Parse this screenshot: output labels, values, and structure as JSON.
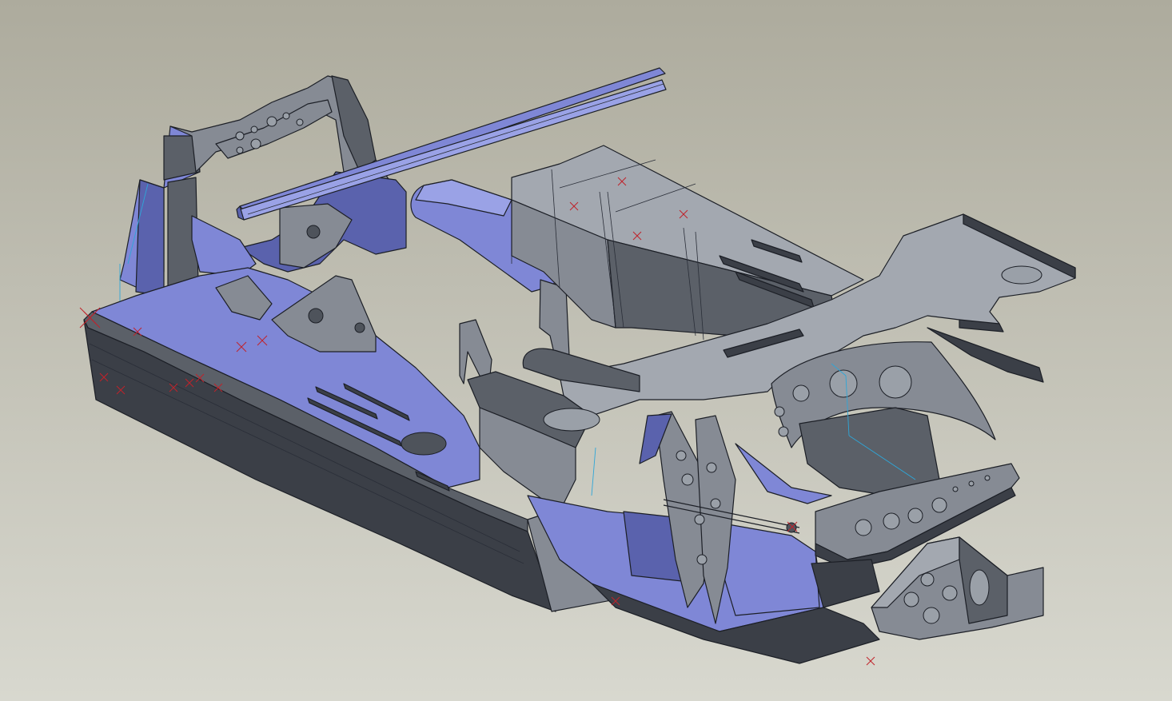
{
  "viewport": {
    "background_top": "#adab9d",
    "background_bottom": "#d8d8cf",
    "edge_color": "#1c1f26",
    "selected_face_color": "#7f87d6",
    "surface_color": "#868b94",
    "marker_color": "#c0222a",
    "construction_line_color": "#2ea6d8"
  },
  "model": {
    "parts": [
      {
        "icon": "upper-frame-bracket"
      },
      {
        "icon": "longitudinal-rail"
      },
      {
        "icon": "cylindrical-duct"
      },
      {
        "icon": "fuel-tank-box"
      },
      {
        "icon": "main-side-sill"
      },
      {
        "icon": "bulkhead-plate"
      },
      {
        "icon": "front-crossmember"
      },
      {
        "icon": "suspension-bracket"
      }
    ]
  }
}
